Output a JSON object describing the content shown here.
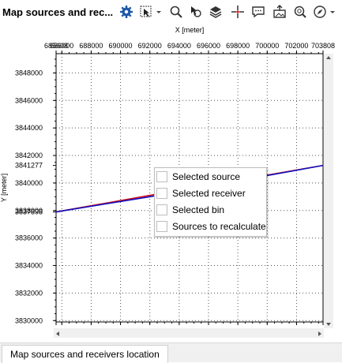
{
  "window": {
    "title": "Map sources and rec..."
  },
  "toolbar": {
    "icons": [
      "gear-icon",
      "select-region-icon",
      "dropdown-arrow-icon",
      "zoom-icon",
      "pointer-link-icon",
      "layers-icon",
      "crosshair-icon",
      "comment-icon",
      "export-image-icon",
      "zoom-fit-icon",
      "compass-icon",
      "dropdown-arrow-icon"
    ]
  },
  "chart_data": {
    "type": "line",
    "xlabel": "X [meter]",
    "ylabel": "Y [meter]",
    "x_ticks": [
      "685608",
      "686000",
      "688000",
      "690000",
      "692000",
      "694000",
      "696000",
      "698000",
      "700000",
      "702000",
      "703808"
    ],
    "y_ticks": [
      "3830000",
      "3832000",
      "3834000",
      "3836000",
      "3837898",
      "3838000",
      "3840000",
      "3841277",
      "3842000",
      "3844000",
      "3846000",
      "3848000"
    ],
    "xlim": [
      685608,
      703808
    ],
    "ylim": [
      3829900,
      3849400
    ],
    "grid": true,
    "series": [
      {
        "color": "#d0101a",
        "x": [
          685608,
          692000,
          703808
        ],
        "y": [
          3837898,
          3839100,
          3841277
        ]
      },
      {
        "color": "#1010c0",
        "x": [
          685608,
          692000,
          703808
        ],
        "y": [
          3837898,
          3839000,
          3841277
        ]
      }
    ]
  },
  "legend": {
    "items": [
      {
        "label": "Selected source"
      },
      {
        "label": "Selected receiver"
      },
      {
        "label": "Selected bin"
      },
      {
        "label": "Sources to recalculate"
      }
    ]
  },
  "tabs": [
    {
      "label": "Map sources and receivers location"
    }
  ],
  "colors": {
    "source": "#d0101a",
    "receiver": "#1010c0",
    "gear": "#1e5aa8"
  }
}
